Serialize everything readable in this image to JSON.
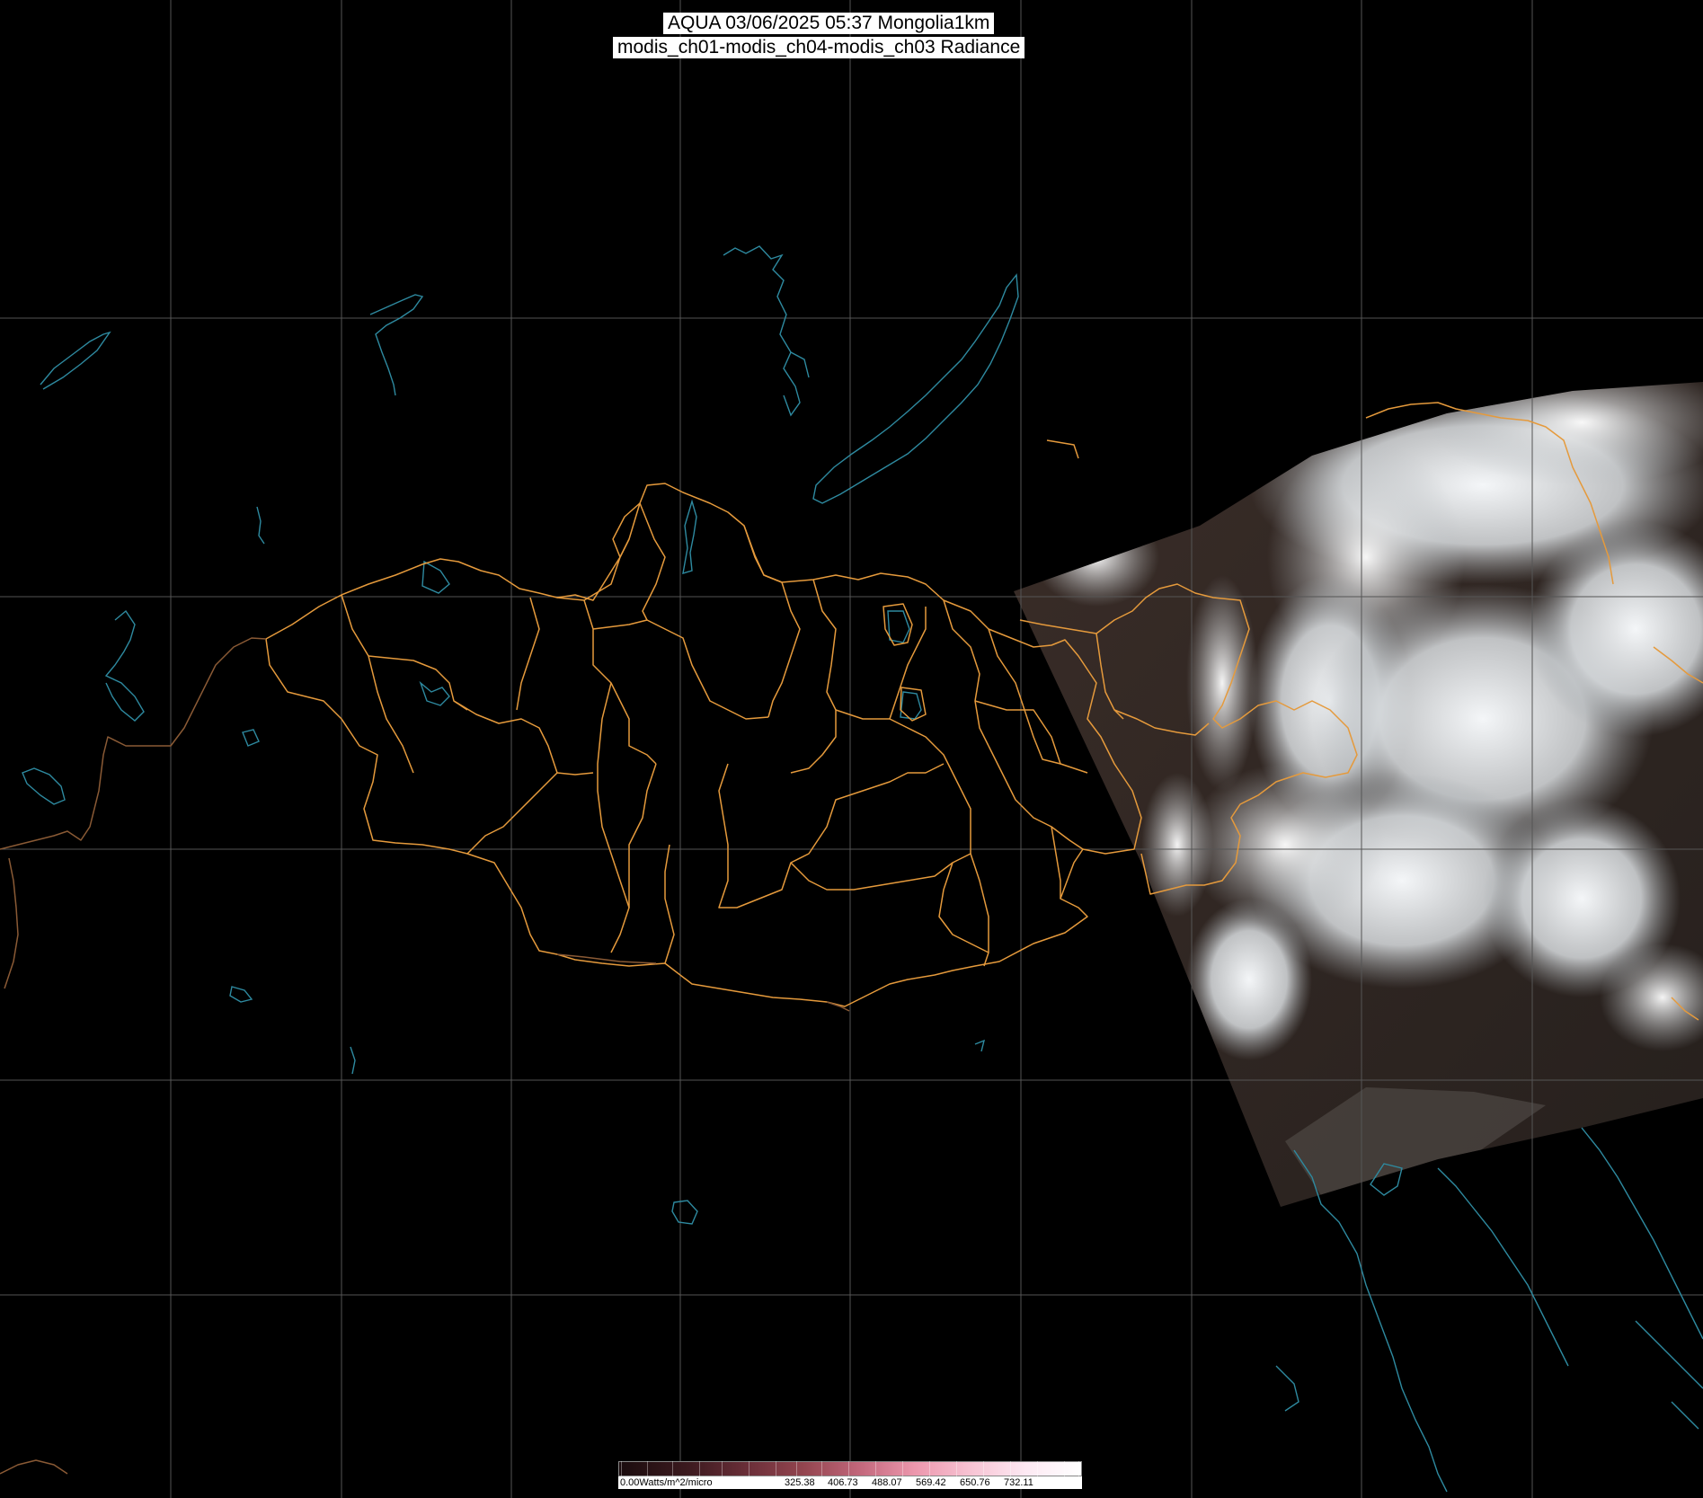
{
  "header": {
    "title_line1": "AQUA 03/06/2025 05:37 Mongolia1km",
    "title_line2": "modis_ch01-modis_ch04-modis_ch03 Radiance"
  },
  "colorbar": {
    "unit_label": "0.00Watts/m^2/micro",
    "tick_labels": [
      "325.38",
      "406.73",
      "488.07",
      "569.42",
      "650.76",
      "732.11"
    ]
  },
  "colors": {
    "background": "#000000",
    "graticule": "#555555",
    "province_border": "#e59a3c",
    "coastline_river": "#2e8aa0",
    "cloud": "#e8ecef",
    "land_swath": "#2b211e"
  }
}
